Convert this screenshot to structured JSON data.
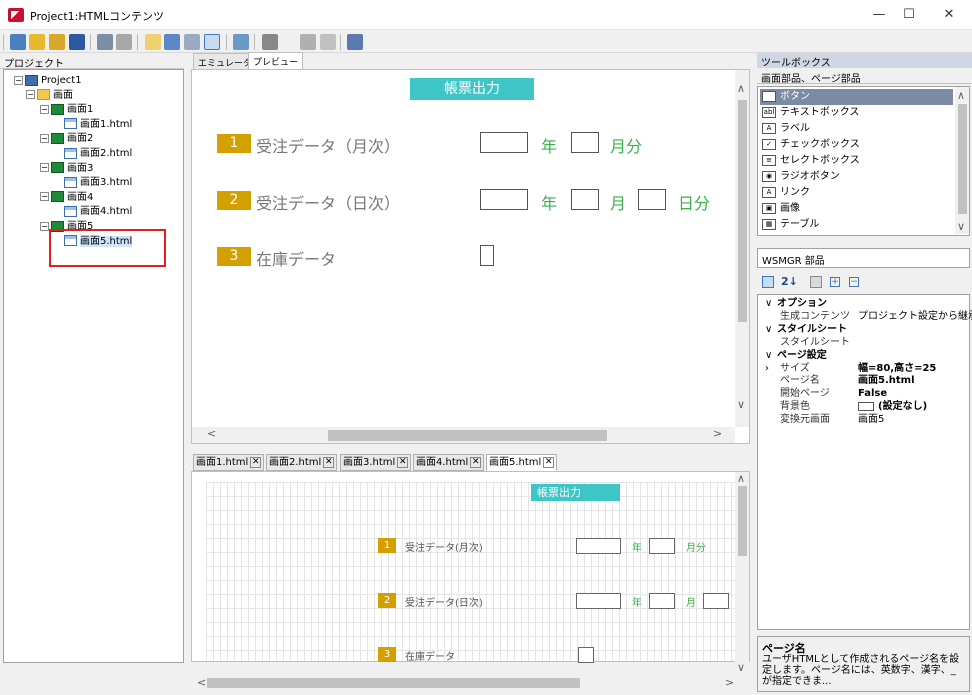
{
  "window": {
    "title": "Project1:HTMLコンテンツ",
    "minimize": "—",
    "maximize": "☐",
    "close": "✕"
  },
  "project_panel": {
    "title": "プロジェクト",
    "tree": [
      {
        "label": "Project1",
        "icon": "project-icon",
        "expander": "−"
      },
      {
        "label": "画面",
        "icon": "folder-icon",
        "expander": "−"
      },
      {
        "label": "画面1",
        "icon": "screen-icon",
        "expander": "−"
      },
      {
        "label": "画面1.html",
        "icon": "html-file-icon"
      },
      {
        "label": "画面2",
        "icon": "screen-icon",
        "expander": "−"
      },
      {
        "label": "画面2.html",
        "icon": "html-file-icon"
      },
      {
        "label": "画面3",
        "icon": "screen-icon",
        "expander": "−"
      },
      {
        "label": "画面3.html",
        "icon": "html-file-icon"
      },
      {
        "label": "画面4",
        "icon": "screen-icon",
        "expander": "−"
      },
      {
        "label": "画面4.html",
        "icon": "html-file-icon"
      },
      {
        "label": "画面5",
        "icon": "screen-icon",
        "expander": "−"
      },
      {
        "label": "画面5.html",
        "icon": "html-file-icon"
      }
    ],
    "highlight_color": "#e02020"
  },
  "view_tabs": [
    {
      "label": "エミュレータ"
    },
    {
      "label": "プレビュー",
      "active": true
    }
  ],
  "preview": {
    "header": "帳票出力",
    "rows": [
      {
        "num": "1",
        "label": "受注データ（月次）",
        "parts": [
          "年",
          "月分"
        ]
      },
      {
        "num": "2",
        "label": "受注データ（日次）",
        "parts": [
          "年",
          "月",
          "日分"
        ]
      },
      {
        "num": "3",
        "label": "在庫データ",
        "parts": []
      }
    ],
    "header_color": "#3ec6c6",
    "num_color": "#d4a000",
    "green": "#3ab04a"
  },
  "doc_tabs": [
    {
      "label": "画面1.html"
    },
    {
      "label": "画面2.html"
    },
    {
      "label": "画面3.html"
    },
    {
      "label": "画面4.html"
    },
    {
      "label": "画面5.html",
      "active": true
    }
  ],
  "designer": {
    "header": "帳票出力",
    "rows": [
      {
        "num": "1",
        "label": "受注データ(月次)",
        "parts": [
          "年",
          "月分"
        ]
      },
      {
        "num": "2",
        "label": "受注データ(日次)",
        "parts": [
          "年",
          "月"
        ]
      },
      {
        "num": "3",
        "label": "在庫データ",
        "parts": []
      }
    ]
  },
  "toolbox": {
    "title": "ツールボックス",
    "category": "画面部品、ページ部品",
    "items": [
      {
        "label": "ボタン",
        "icon": "ab",
        "selected": true
      },
      {
        "label": "テキストボックス",
        "icon": "abl"
      },
      {
        "label": "ラベル",
        "icon": "A"
      },
      {
        "label": "チェックボックス",
        "icon": "✓"
      },
      {
        "label": "セレクトボックス",
        "icon": "≡"
      },
      {
        "label": "ラジオボタン",
        "icon": "◉"
      },
      {
        "label": "リンク",
        "icon": "A"
      },
      {
        "label": "画像",
        "icon": "▣"
      },
      {
        "label": "テーブル",
        "icon": "▦"
      }
    ]
  },
  "properties": {
    "title": "WSMGR 部品",
    "rows": [
      {
        "type": "cat",
        "expander": "∨",
        "key": "オプション"
      },
      {
        "type": "prop",
        "key": "生成コンテンツ",
        "value": "プロジェクト設定から継承"
      },
      {
        "type": "cat",
        "expander": "∨",
        "key": "スタイルシート"
      },
      {
        "type": "prop",
        "key": "スタイルシート",
        "value": ""
      },
      {
        "type": "cat",
        "expander": "∨",
        "key": "ページ設定"
      },
      {
        "type": "prop",
        "expander": "›",
        "key": "サイズ",
        "value": "幅=80,高さ=25",
        "bold": true
      },
      {
        "type": "prop",
        "key": "ページ名",
        "value": "画面5.html",
        "bold": true
      },
      {
        "type": "prop",
        "key": "開始ページ",
        "value": "False",
        "bold": true
      },
      {
        "type": "prop",
        "key": "背景色",
        "value": "(設定なし)",
        "bold": true,
        "swatch": true
      },
      {
        "type": "prop",
        "key": "変換元画面",
        "value": "画面5"
      }
    ],
    "description": {
      "title": "ページ名",
      "text": "ユーザHTMLとして作成されるページ名を設定します。ページ名には、英数字、漢字、_ が指定できま..."
    }
  }
}
